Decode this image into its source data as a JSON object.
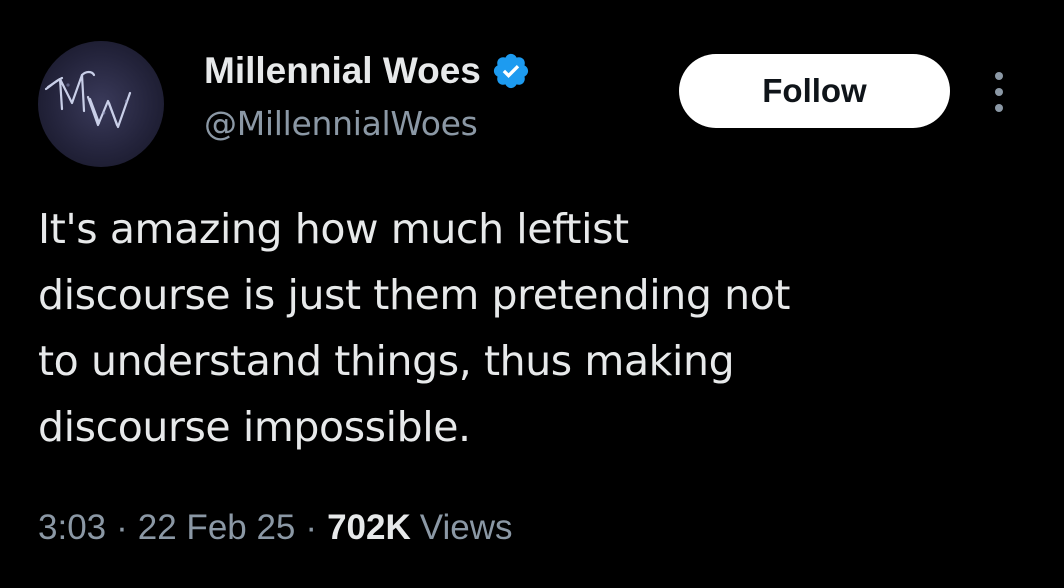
{
  "author": {
    "display_name": "Millennial Woes",
    "handle": "@MillennialWoes",
    "avatar_monogram": "MW",
    "verified": true,
    "verified_color": "#1d9bf0"
  },
  "actions": {
    "follow_label": "Follow",
    "more_icon": "more-vertical-icon"
  },
  "tweet": {
    "text_lines": [
      "It's amazing how much leftist",
      "discourse is just them pretending not",
      "to understand things, thus making",
      "discourse impossible."
    ]
  },
  "meta": {
    "time": "3:03",
    "separator": "·",
    "date": "22 Feb 25",
    "views_count": "702K",
    "views_label": "Views"
  },
  "colors": {
    "background": "#000000",
    "primary_text": "#e7e9ea",
    "secondary_text": "#8b98a5"
  }
}
